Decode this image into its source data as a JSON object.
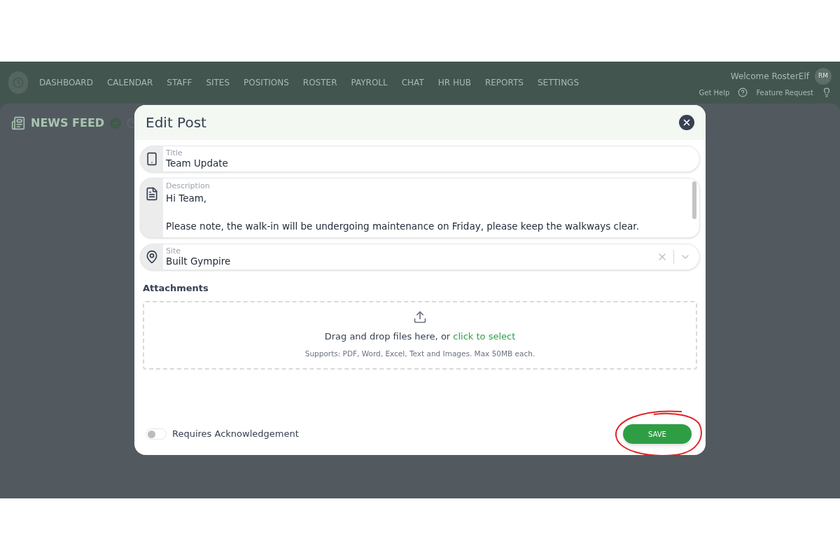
{
  "nav": {
    "items": [
      {
        "label": "DASHBOARD"
      },
      {
        "label": "CALENDAR"
      },
      {
        "label": "STAFF"
      },
      {
        "label": "SITES"
      },
      {
        "label": "POSITIONS"
      },
      {
        "label": "ROSTER"
      },
      {
        "label": "PAYROLL"
      },
      {
        "label": "CHAT"
      },
      {
        "label": "HR HUB"
      },
      {
        "label": "REPORTS"
      },
      {
        "label": "SETTINGS"
      }
    ],
    "welcome": "Welcome RosterElf",
    "avatar": "RM",
    "get_help": "Get Help",
    "feature_request": "Feature Request"
  },
  "page": {
    "title": "NEWS FEED"
  },
  "modal": {
    "title": "Edit Post",
    "fields": [
      {
        "kind": "input",
        "label": "Title",
        "value": "Team Update"
      },
      {
        "kind": "textarea",
        "label": "Description",
        "paragraphs": [
          "Hi Team,",
          "Please note, the walk-in will be undergoing maintenance on Friday, please keep the walkways clear."
        ]
      },
      {
        "kind": "select",
        "label": "Site",
        "value": "Built Gympire"
      }
    ],
    "attachments": {
      "heading": "Attachments",
      "prompt": "Drag and drop files here, or",
      "link": "click to select",
      "hint": "Supports: PDF, Word, Excel, Text and Images. Max 50MB each."
    },
    "acknowledgement": {
      "label": "Requires Acknowledgement",
      "on": false
    },
    "save": "SAVE"
  }
}
